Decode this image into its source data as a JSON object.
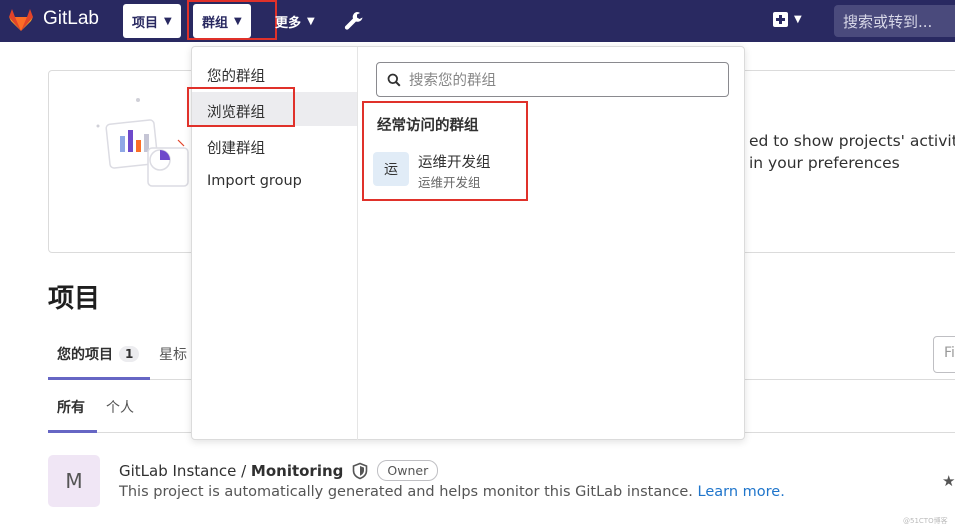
{
  "topbar": {
    "brand": "GitLab",
    "nav_projects": "项目",
    "nav_groups": "群组",
    "nav_more": "更多",
    "search_placeholder": "搜索或转到..."
  },
  "welcome": {
    "line1": "ed to show projects' activity, g",
    "line2": "in your preferences"
  },
  "page": {
    "title": "项目",
    "tab_your_projects": "您的项目",
    "tab_your_projects_count": "1",
    "tab_starred": "星标",
    "filter_placeholder": "Fi",
    "subtab_all": "所有",
    "subtab_personal": "个人"
  },
  "project": {
    "avatar_letter": "M",
    "namespace": "GitLab Instance / ",
    "name": "Monitoring",
    "role": "Owner",
    "description": "This project is automatically generated and helps monitor this GitLab instance.",
    "learn_more": "Learn more."
  },
  "dropdown": {
    "menu": [
      "您的群组",
      "浏览群组",
      "创建群组",
      "Import group"
    ],
    "search_placeholder": "搜索您的群组",
    "frequent_title": "经常访问的群组",
    "group_avatar": "运",
    "group_name": "运维开发组",
    "group_path": "运维开发组"
  },
  "watermark": "@51CTO博客",
  "colors": {
    "topbar": "#292961",
    "accent": "#6666c4",
    "annotation": "#e0312a",
    "link": "#1f75cb"
  }
}
